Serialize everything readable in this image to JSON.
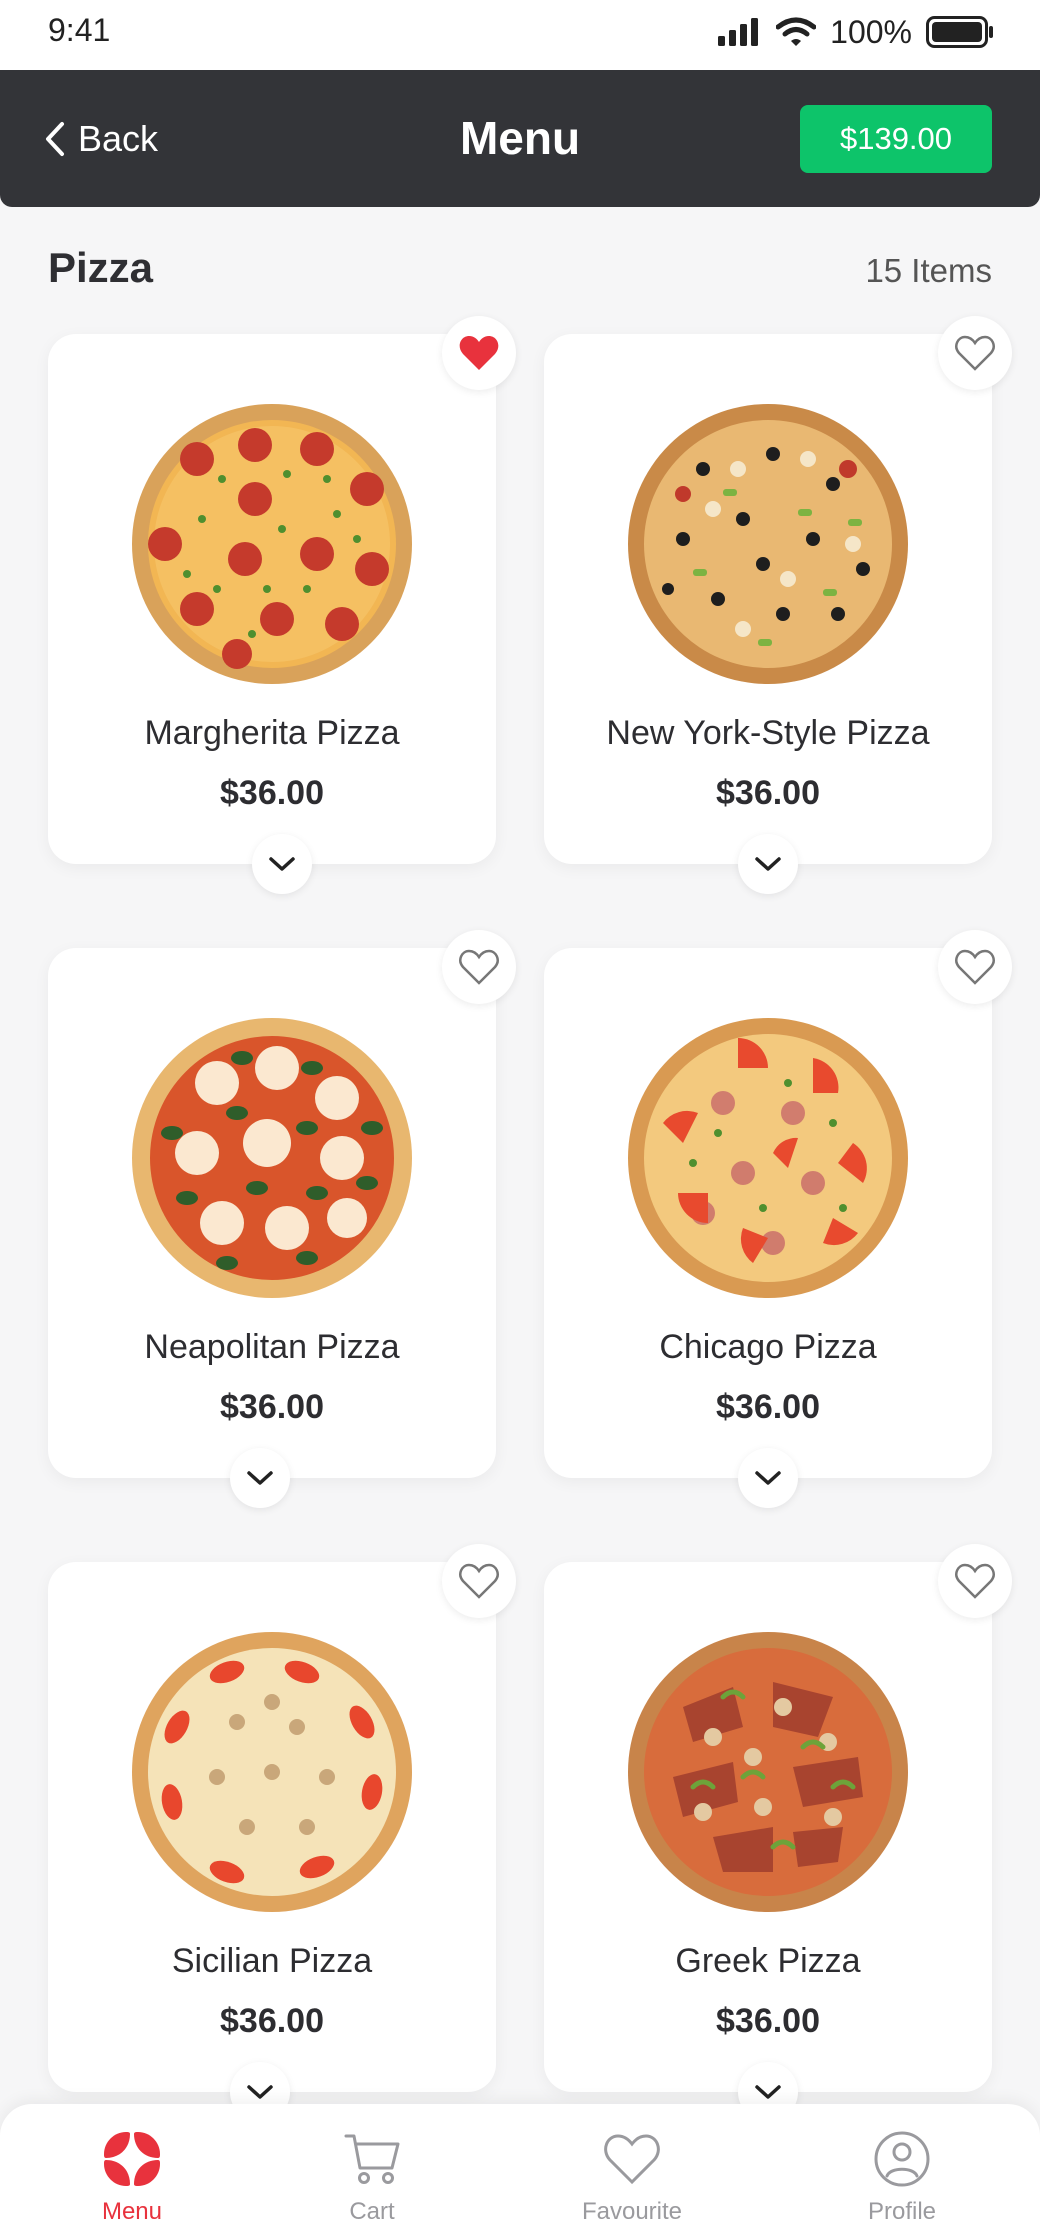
{
  "status": {
    "time": "9:41",
    "battery": "100%"
  },
  "header": {
    "back_label": "Back",
    "title": "Menu",
    "cart_total": "$139.00"
  },
  "section": {
    "title": "Pizza",
    "count": "15 Items"
  },
  "products": [
    {
      "name": "Margherita Pizza",
      "price": "$36.00",
      "favourite": true,
      "style": "pepperoni"
    },
    {
      "name": "New York-Style Pizza",
      "price": "$36.00",
      "favourite": false,
      "style": "supreme"
    },
    {
      "name": "Neapolitan Pizza",
      "price": "$36.00",
      "favourite": false,
      "style": "neapolitan"
    },
    {
      "name": "Chicago Pizza",
      "price": "$36.00",
      "favourite": false,
      "style": "tomato"
    },
    {
      "name": "Sicilian Pizza",
      "price": "$36.00",
      "favourite": false,
      "style": "mushroom"
    },
    {
      "name": "Greek Pizza",
      "price": "$36.00",
      "favourite": false,
      "style": "meat"
    }
  ],
  "nav": {
    "items": [
      {
        "label": "Menu",
        "icon": "menu-icon",
        "active": true
      },
      {
        "label": "Cart",
        "icon": "cart-icon",
        "active": false
      },
      {
        "label": "Favourite",
        "icon": "heart-icon",
        "active": false
      },
      {
        "label": "Profile",
        "icon": "profile-icon",
        "active": false
      }
    ]
  },
  "colors": {
    "accent": "#e8323d",
    "primary": "#0dc46a",
    "header": "#333438"
  }
}
